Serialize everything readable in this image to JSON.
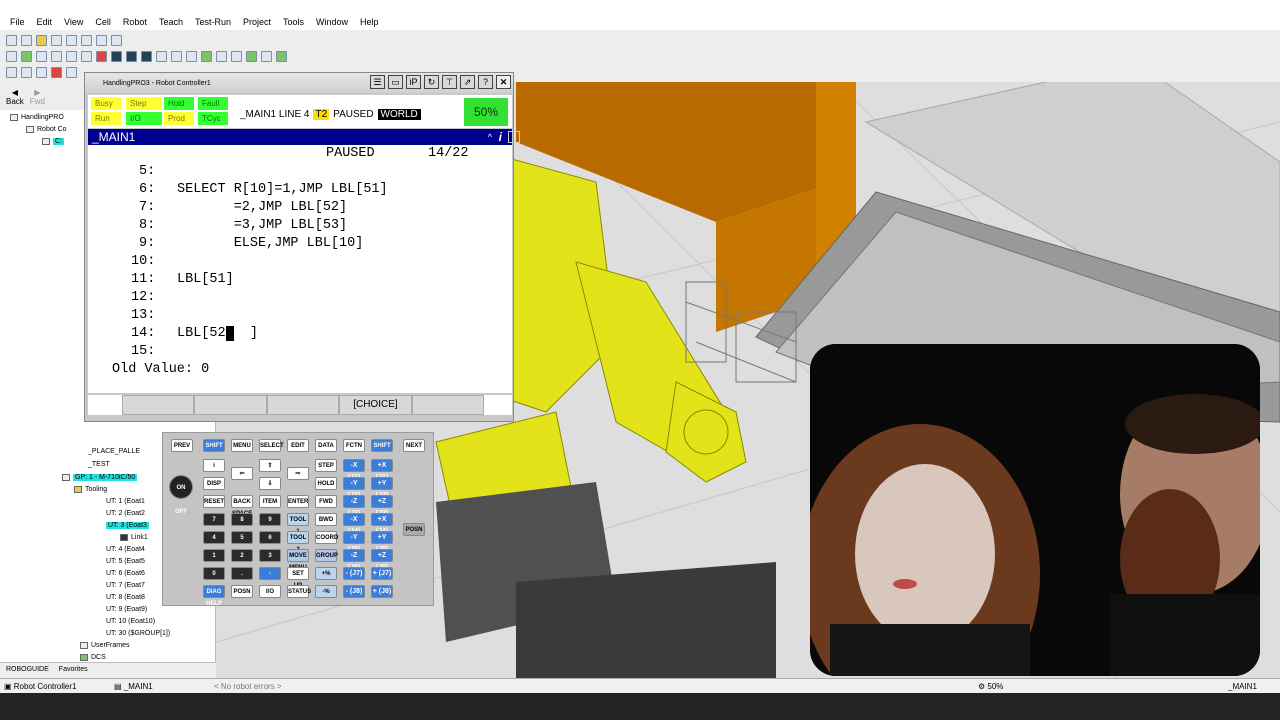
{
  "menu": [
    "File",
    "Edit",
    "View",
    "Cell",
    "Robot",
    "Teach",
    "Test-Run",
    "Project",
    "Tools",
    "Window",
    "Help"
  ],
  "nav": {
    "back": "Back",
    "fwd": "Fwd"
  },
  "tree": {
    "items": [
      {
        "label": "HandlingPRO"
      },
      {
        "label": "Robot Co"
      },
      {
        "label": "C:"
      },
      {
        "label": "_PLACE_PALLE"
      },
      {
        "label": "_TEST"
      },
      {
        "label": "GP: 1 - M-710iC/50"
      },
      {
        "label": "Tooling"
      },
      {
        "label": "UT: 1 (Eoat1"
      },
      {
        "label": "UT: 2 (Eoat2"
      },
      {
        "label": "UT: 3 (Eoat3"
      },
      {
        "label": "Link1"
      },
      {
        "label": "UT: 4 (Eoat4"
      },
      {
        "label": "UT: 5 (Eoat5"
      },
      {
        "label": "UT: 6 (Eoat6"
      },
      {
        "label": "UT: 7 (Eoat7"
      },
      {
        "label": "UT: 8 (Eoat8"
      },
      {
        "label": "UT: 9 (Eoat9)"
      },
      {
        "label": "UT: 10 (Eoat10)"
      },
      {
        "label": "UT: 30 ($GROUP[1])"
      },
      {
        "label": "UserFrames"
      },
      {
        "label": "DCS"
      }
    ]
  },
  "bottom_tabs": [
    "ROBOGUIDE",
    "Favorites"
  ],
  "statusbar": {
    "controller": "Robot Controller1",
    "program": "_MAIN1",
    "errors": "< No robot errors >",
    "zoom": "50%",
    "right_prog": "_MAIN1"
  },
  "teach_pendant": {
    "title": "HandlingPRO3 - Robot Controller1",
    "title_icons": [
      "☰",
      "▭",
      "iP",
      "↻",
      "⊤",
      "⇗",
      "?",
      "✕"
    ],
    "leds": {
      "busy": "Busy",
      "step": "Step",
      "hold": "Hold",
      "fault": "Fault",
      "run": "Run",
      "io": "I/O",
      "prod": "Prod",
      "tcyc": "TCyc"
    },
    "status_text": "_MAIN1 LINE 4",
    "mode": "T2",
    "state": "PAUSED",
    "frame": "WORLD",
    "speed": "50%",
    "program_name": "_MAIN1",
    "header": {
      "state": "PAUSED",
      "position": "14/22"
    },
    "lines": [
      {
        "num": "5:",
        "text": ""
      },
      {
        "num": "6:",
        "text": "SELECT R[10]=1,JMP LBL[51]"
      },
      {
        "num": "7:",
        "text": "       =2,JMP LBL[52]"
      },
      {
        "num": "8:",
        "text": "       =3,JMP LBL[53]"
      },
      {
        "num": "9:",
        "text": "       ELSE,JMP LBL[10]"
      },
      {
        "num": "10:",
        "text": ""
      },
      {
        "num": "11:",
        "text": "LBL[51]"
      },
      {
        "num": "12:",
        "text": ""
      },
      {
        "num": "13:",
        "text": ""
      },
      {
        "num": "14:",
        "text": "LBL[52"
      },
      {
        "num": "15:",
        "text": ""
      }
    ],
    "line14_tail": "]",
    "old_value": "Old Value: 0",
    "fkeys": [
      "",
      "",
      "",
      "[CHOICE]",
      ""
    ]
  },
  "keypad": {
    "row1": [
      "PREV",
      "SHIFT",
      "MENU",
      "SELECT",
      "EDIT",
      "DATA",
      "FCTN",
      "SHIFT",
      "NEXT"
    ],
    "step": "STEP",
    "hold": "HOLD",
    "fwd": "FWD",
    "bwd": "BWD",
    "coord": "COORD",
    "group": "GROUP",
    "reset": "RESET",
    "backspace": "BACK SPACE",
    "item": "ITEM",
    "enter": "ENTER",
    "disp": "DISP",
    "info": "i",
    "diag": "DIAG HELP",
    "posn": "POSN",
    "io": "I/O",
    "status": "STATUS",
    "move_menu": "MOVE MENU",
    "setup": "SET UP",
    "tool1": "TOOL 1",
    "tool2": "TOOL 2",
    "digits": [
      "7",
      "8",
      "9",
      "4",
      "5",
      "6",
      "1",
      "2",
      "3",
      "0",
      "."
    ],
    "minus": "-",
    "posn_side": "POSN",
    "onoff": "ON OFF",
    "jog_neg": [
      "-X (J1)",
      "-Y (J2)",
      "-Z (J3)",
      "-X (J4)",
      "-Y (J5)",
      "-Z (J6)",
      "- (J7)",
      "- (J8)"
    ],
    "jog_pos": [
      "+X (J1)",
      "+Y (J2)",
      "+Z (J3)",
      "+X (J4)",
      "+Y (J5)",
      "+Z (J6)",
      "+ (J7)",
      "+ (J8)"
    ]
  }
}
